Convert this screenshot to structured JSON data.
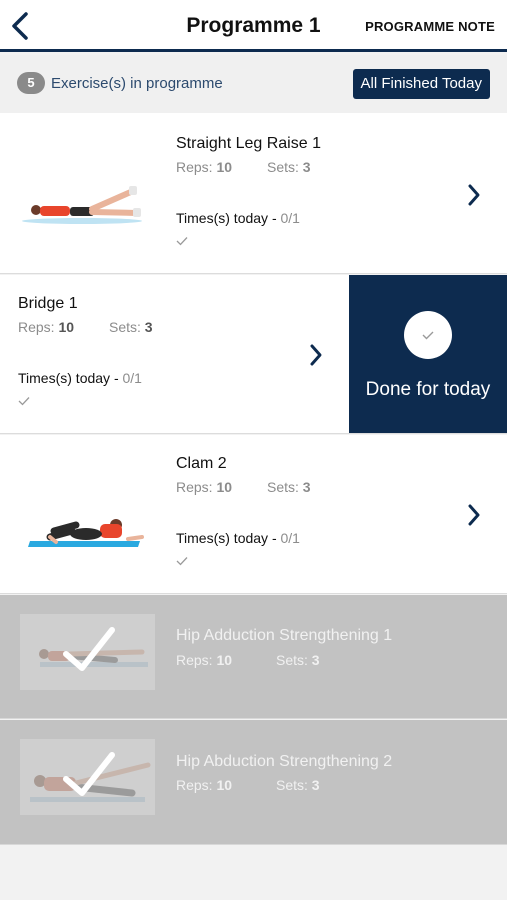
{
  "header": {
    "title": "Programme 1",
    "note_label": "PROGRAMME NOTE"
  },
  "summary": {
    "count": "5",
    "text": "Exercise(s) in programme",
    "finish_button": "All Finished Today"
  },
  "exercises": [
    {
      "name": "Straight Leg Raise 1",
      "reps_label": "Reps:",
      "reps": "10",
      "sets_label": "Sets:",
      "sets": "3",
      "times_label": "Times(s) today -",
      "times_value": "0/1"
    },
    {
      "name": "Bridge 1",
      "reps_label": "Reps:",
      "reps": "10",
      "sets_label": "Sets:",
      "sets": "3",
      "times_label": "Times(s) today -",
      "times_value": "0/1",
      "done_label": "Done for today"
    },
    {
      "name": "Clam 2",
      "reps_label": "Reps:",
      "reps": "10",
      "sets_label": "Sets:",
      "sets": "3",
      "times_label": "Times(s) today -",
      "times_value": "0/1"
    },
    {
      "name": "Hip Adduction Strengthening 1",
      "reps_label": "Reps:",
      "reps": "10",
      "sets_label": "Sets:",
      "sets": "3",
      "completed": true
    },
    {
      "name": "Hip Abduction Strengthening 2",
      "reps_label": "Reps:",
      "reps": "10",
      "sets_label": "Sets:",
      "sets": "3",
      "completed": true
    }
  ],
  "colors": {
    "navy": "#0d2b4f",
    "completed_overlay": "#c2c2c2",
    "mat": "#2aa9e0",
    "shirt": "#e8452c"
  }
}
